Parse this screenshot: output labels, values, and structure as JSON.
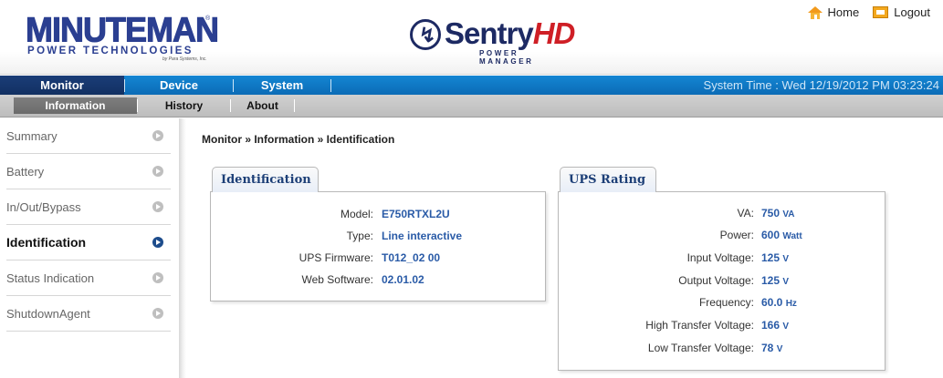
{
  "brand": {
    "minuteman": "MINUTEMAN",
    "minuteman_sub": "POWER TECHNOLOGIES",
    "minuteman_tag": "by Para Systems, Inc.",
    "reg": "®",
    "sentry_main": "Sentry",
    "sentry_hd": "HD",
    "sentry_sub": "POWER MANAGER"
  },
  "top_links": {
    "home": "Home",
    "logout": "Logout"
  },
  "nav": {
    "items": [
      "Monitor",
      "Device",
      "System"
    ],
    "active": "Monitor",
    "system_time": "System Time : Wed 12/19/2012 PM 03:23:24"
  },
  "subnav": {
    "items": [
      "Information",
      "History",
      "About"
    ],
    "active": "Information"
  },
  "sidebar": {
    "items": [
      {
        "label": "Summary"
      },
      {
        "label": "Battery"
      },
      {
        "label": "In/Out/Bypass"
      },
      {
        "label": "Identification"
      },
      {
        "label": "Status Indication"
      },
      {
        "label": "ShutdownAgent"
      }
    ],
    "active": "Identification"
  },
  "breadcrumb": "Monitor » Information » Identification",
  "identification": {
    "title": "Identification",
    "rows": [
      {
        "label": "Model:",
        "value": "E750RTXL2U",
        "unit": ""
      },
      {
        "label": "Type:",
        "value": "Line interactive",
        "unit": ""
      },
      {
        "label": "UPS Firmware:",
        "value": "T012_02 00",
        "unit": ""
      },
      {
        "label": "Web Software:",
        "value": "02.01.02",
        "unit": ""
      }
    ]
  },
  "ups_rating": {
    "title": "UPS Rating",
    "rows": [
      {
        "label": "VA:",
        "value": "750",
        "unit": "VA"
      },
      {
        "label": "Power:",
        "value": "600",
        "unit": "Watt"
      },
      {
        "label": "Input Voltage:",
        "value": "125",
        "unit": "V"
      },
      {
        "label": "Output Voltage:",
        "value": "125",
        "unit": "V"
      },
      {
        "label": "Frequency:",
        "value": "60.0",
        "unit": "Hz"
      },
      {
        "label": "High Transfer Voltage:",
        "value": "166",
        "unit": "V"
      },
      {
        "label": "Low Transfer Voltage:",
        "value": "78",
        "unit": "V"
      }
    ]
  },
  "colors": {
    "nav_blue": "#0b6bb6",
    "nav_active": "#123062",
    "value_blue": "#2a5ba7"
  }
}
